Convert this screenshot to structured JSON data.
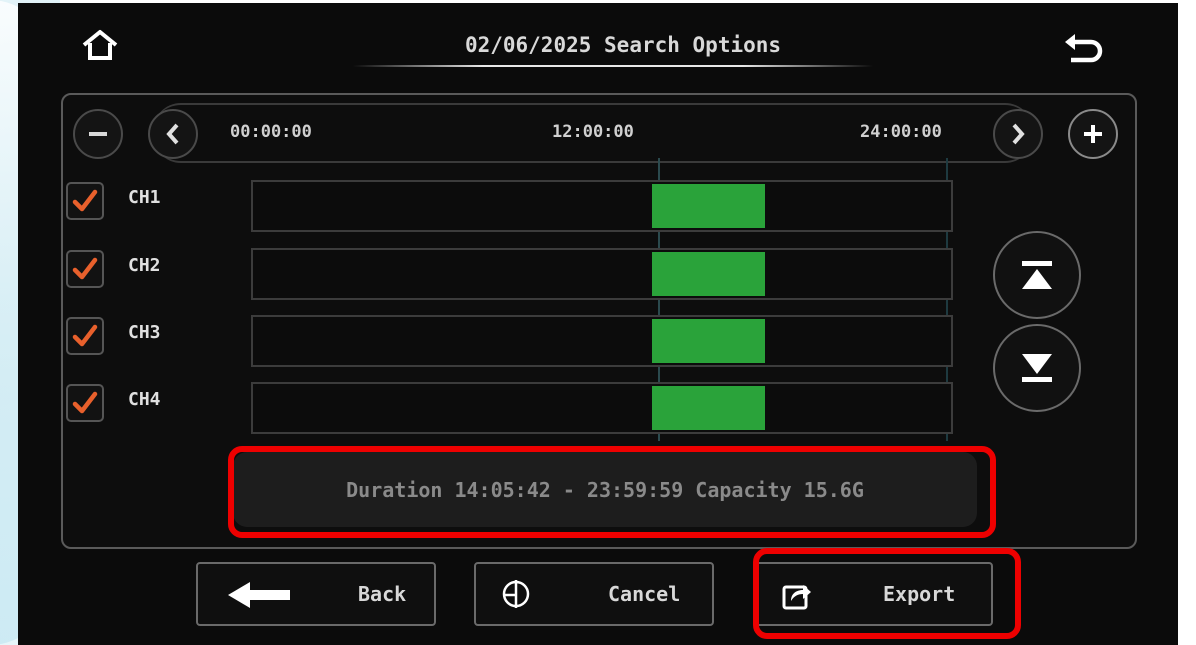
{
  "header": {
    "title": "02/06/2025 Search Options",
    "home_icon": "home-icon",
    "back_icon": "return-arrow-icon"
  },
  "timeline": {
    "zoom_out_icon": "minus-icon",
    "zoom_in_icon": "plus-icon",
    "prev_icon": "chevron-left-icon",
    "next_icon": "chevron-right-icon",
    "ticks": [
      "00:00:00",
      "12:00:00",
      "24:00:00"
    ]
  },
  "channels": [
    {
      "label": "CH1",
      "checked": true,
      "recording": {
        "start_fraction": 0.571,
        "end_fraction": 0.734
      }
    },
    {
      "label": "CH2",
      "checked": true,
      "recording": {
        "start_fraction": 0.571,
        "end_fraction": 0.734
      }
    },
    {
      "label": "CH3",
      "checked": true,
      "recording": {
        "start_fraction": 0.571,
        "end_fraction": 0.734
      }
    },
    {
      "label": "CH4",
      "checked": true,
      "recording": {
        "start_fraction": 0.571,
        "end_fraction": 0.734
      }
    }
  ],
  "scroll": {
    "top_icon": "scroll-to-top-icon",
    "bottom_icon": "scroll-to-bottom-icon"
  },
  "info": {
    "text": "Duration 14:05:42 - 23:59:59   Capacity 15.6G"
  },
  "buttons": {
    "back_label": "Back",
    "cancel_label": "Cancel",
    "export_label": "Export"
  },
  "colors": {
    "recording": "#2aa33a",
    "checkmark": "#e8602c",
    "highlight": "#ee0000",
    "background": "#0b0b0b"
  }
}
